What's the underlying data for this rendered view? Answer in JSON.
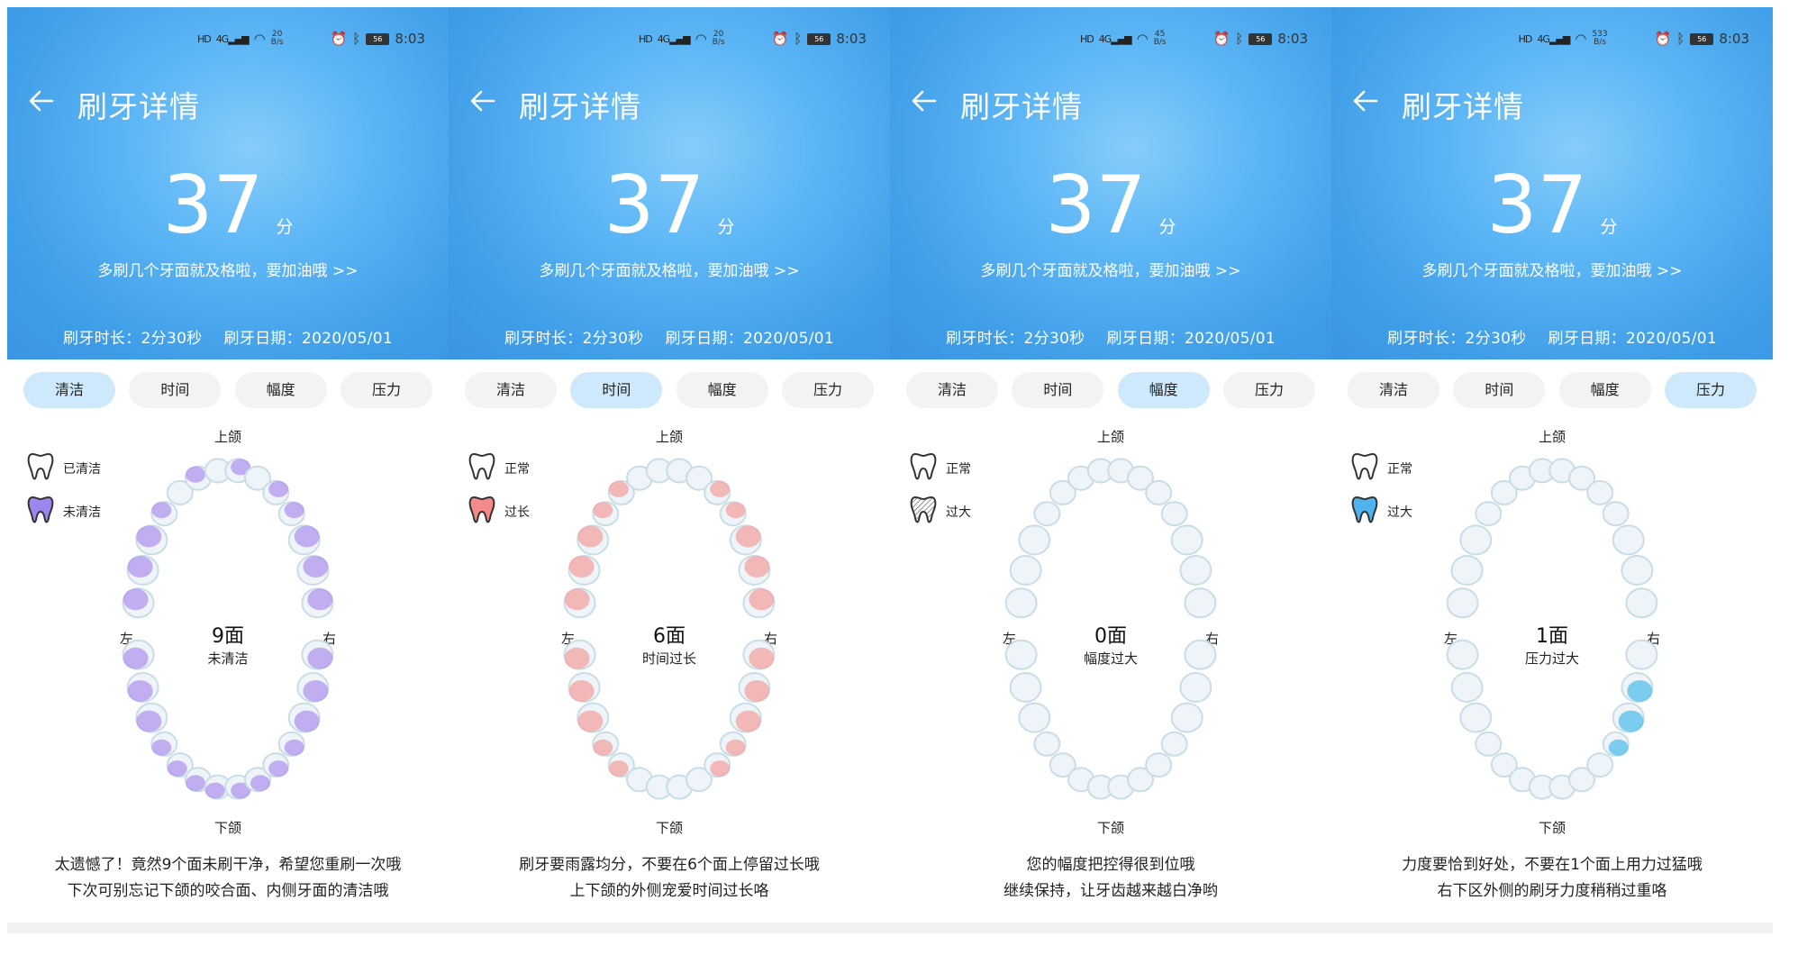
{
  "screens": [
    {
      "status": {
        "hd": "HD",
        "net": "4G",
        "speed_top": "20",
        "speed_unit": "B/s",
        "battery": "56",
        "time": "8:03"
      },
      "title": "刷牙详情",
      "score": "37",
      "score_unit": "分",
      "tip": "多刷几个牙面就及格啦，要加油哦 >>",
      "duration": "刷牙时长：2分30秒",
      "date": "刷牙日期：2020/05/01",
      "tabs": [
        "清洁",
        "时间",
        "幅度",
        "压力"
      ],
      "active_tab": 0,
      "legend": [
        {
          "label": "已清洁",
          "style": "outline"
        },
        {
          "label": "未清洁",
          "style": "purple"
        }
      ],
      "jaw": {
        "upper": "上颌",
        "lower": "下颌",
        "left": "左",
        "right": "右"
      },
      "count": "9面",
      "count_label": "未清洁",
      "message": [
        "太遗憾了！竟然9个面未刷干净，希望您重刷一次哦",
        "下次可别忘记下颌的咬合面、内侧牙面的清洁哦"
      ],
      "highlight_color": "#b39af0",
      "highlight": "purple"
    },
    {
      "status": {
        "hd": "HD",
        "net": "4G",
        "speed_top": "20",
        "speed_unit": "B/s",
        "battery": "56",
        "time": "8:03"
      },
      "title": "刷牙详情",
      "score": "37",
      "score_unit": "分",
      "tip": "多刷几个牙面就及格啦，要加油哦 >>",
      "duration": "刷牙时长：2分30秒",
      "date": "刷牙日期：2020/05/01",
      "tabs": [
        "清洁",
        "时间",
        "幅度",
        "压力"
      ],
      "active_tab": 1,
      "legend": [
        {
          "label": "正常",
          "style": "outline"
        },
        {
          "label": "过长",
          "style": "red"
        }
      ],
      "jaw": {
        "upper": "上颌",
        "lower": "下颌",
        "left": "左",
        "right": "右"
      },
      "count": "6面",
      "count_label": "时间过长",
      "message": [
        "刷牙要雨露均分，不要在6个面上停留过长哦",
        "上下颌的外侧宠爱时间过长咯"
      ],
      "highlight_color": "#f4a7a7",
      "highlight": "red"
    },
    {
      "status": {
        "hd": "HD",
        "net": "4G",
        "speed_top": "45",
        "speed_unit": "B/s",
        "battery": "56",
        "time": "8:03"
      },
      "title": "刷牙详情",
      "score": "37",
      "score_unit": "分",
      "tip": "多刷几个牙面就及格啦，要加油哦 >>",
      "duration": "刷牙时长：2分30秒",
      "date": "刷牙日期：2020/05/01",
      "tabs": [
        "清洁",
        "时间",
        "幅度",
        "压力"
      ],
      "active_tab": 2,
      "legend": [
        {
          "label": "正常",
          "style": "outline"
        },
        {
          "label": "过大",
          "style": "hatched"
        }
      ],
      "jaw": {
        "upper": "上颌",
        "lower": "下颌",
        "left": "左",
        "right": "右"
      },
      "count": "0面",
      "count_label": "幅度过大",
      "message": [
        "您的幅度把控得很到位哦",
        "继续保持，让牙齿越来越白净哟"
      ],
      "highlight_color": "#dfeef3",
      "highlight": "none"
    },
    {
      "status": {
        "hd": "HD",
        "net": "4G",
        "speed_top": "533",
        "speed_unit": "B/s",
        "battery": "56",
        "time": "8:03"
      },
      "title": "刷牙详情",
      "score": "37",
      "score_unit": "分",
      "tip": "多刷几个牙面就及格啦，要加油哦 >>",
      "duration": "刷牙时长：2分30秒",
      "date": "刷牙日期：2020/05/01",
      "tabs": [
        "清洁",
        "时间",
        "幅度",
        "压力"
      ],
      "active_tab": 3,
      "legend": [
        {
          "label": "正常",
          "style": "outline"
        },
        {
          "label": "过大",
          "style": "blue"
        }
      ],
      "jaw": {
        "upper": "上颌",
        "lower": "下颌",
        "left": "左",
        "right": "右"
      },
      "count": "1面",
      "count_label": "压力过大",
      "message": [
        "力度要恰到好处，不要在1个面上用力过猛哦",
        "右下区外侧的刷牙力度稍稍过重咯"
      ],
      "highlight_color": "#5cc0ee",
      "highlight": "blue"
    }
  ]
}
